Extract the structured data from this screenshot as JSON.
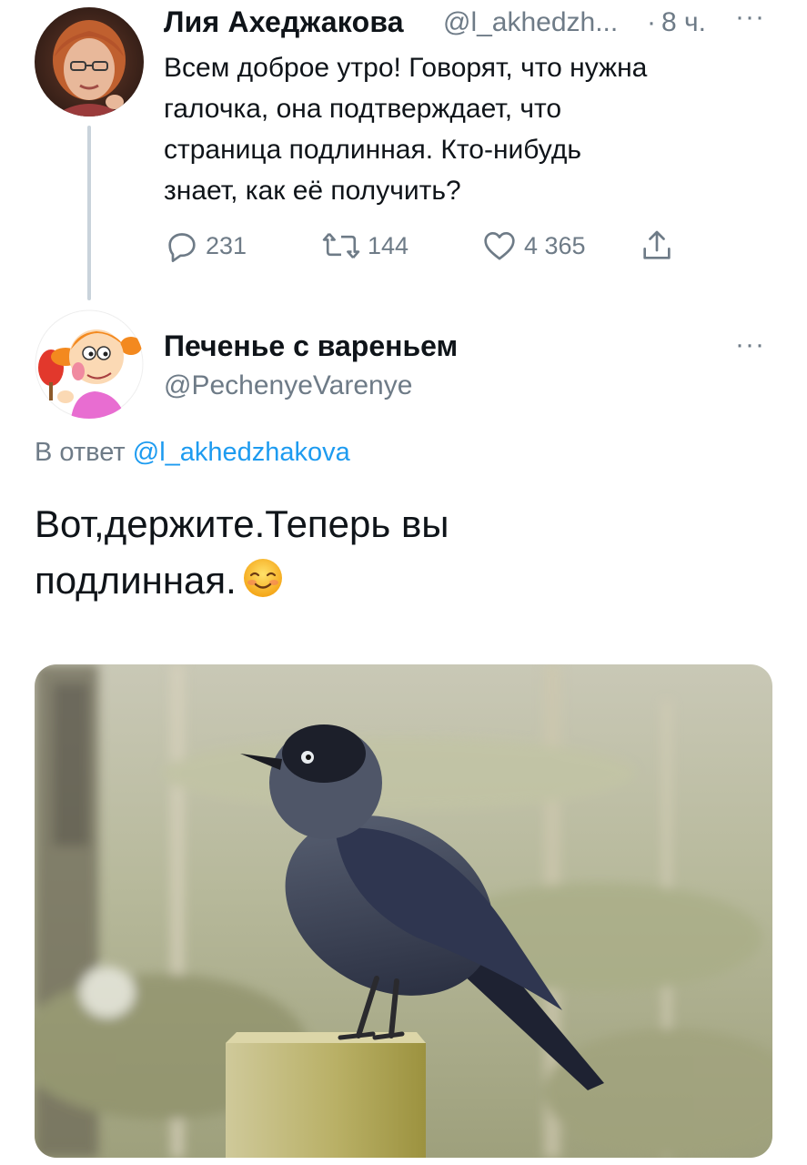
{
  "tweet_main": {
    "author_name": "Лия Ахеджакова",
    "author_handle": "@l_akhedzh...",
    "separator": "·",
    "time": "8 ч.",
    "more": "···",
    "text": "Всем доброе утро! Говорят, что нужна\nгалочка, она подтверждает, что\nстраница подлинная. Кто-нибудь\nзнает, как её получить?",
    "reply_count": "231",
    "retweet_count": "144",
    "like_count": "4 365",
    "icons": [
      "reply-icon",
      "retweet-icon",
      "like-icon",
      "share-icon"
    ]
  },
  "tweet_reply": {
    "author_name": "Печенье с вареньем",
    "author_handle": "@PechenyeVarenye",
    "more": "···",
    "reply_to_prefix": "В ответ",
    "reply_to_handle": "@l_akhedzhakova",
    "text": "Вот,держите.Теперь вы\nподлинная.",
    "emoji_icon": "smiling-face-icon"
  },
  "colors": {
    "link": "#1d9bf0",
    "muted": "#6e7b87",
    "thread_line": "#c9d3db"
  }
}
